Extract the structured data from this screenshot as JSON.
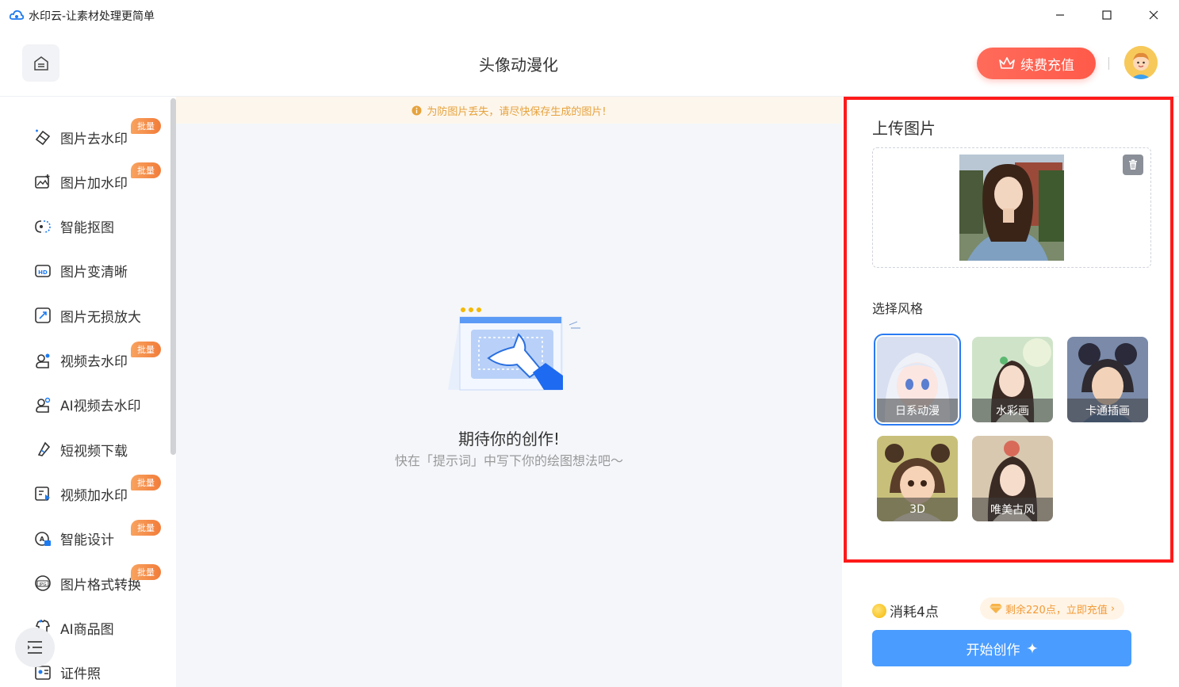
{
  "window": {
    "title": "水印云-让素材处理更简单",
    "minimize_icon": "minimize-icon",
    "maximize_icon": "maximize-icon",
    "close_icon": "close-icon"
  },
  "header": {
    "page_title": "头像动漫化",
    "renew_label": "续费充值",
    "accent": "#ff5a4a"
  },
  "sidebar": {
    "badge_label": "批量",
    "items": [
      {
        "label": "图片去水印",
        "icon": "eraser-icon",
        "badge": true
      },
      {
        "label": "图片加水印",
        "icon": "image-add-icon",
        "badge": true
      },
      {
        "label": "智能抠图",
        "icon": "cutout-icon",
        "badge": false
      },
      {
        "label": "图片变清晰",
        "icon": "hd-icon",
        "badge": false
      },
      {
        "label": "图片无损放大",
        "icon": "enlarge-icon",
        "badge": false
      },
      {
        "label": "视频去水印",
        "icon": "video-eraser-icon",
        "badge": true
      },
      {
        "label": "AI视频去水印",
        "icon": "ai-video-icon",
        "badge": false
      },
      {
        "label": "短视频下载",
        "icon": "download-icon",
        "badge": false
      },
      {
        "label": "视频加水印",
        "icon": "video-add-icon",
        "badge": true
      },
      {
        "label": "智能设计",
        "icon": "design-icon",
        "badge": true
      },
      {
        "label": "图片格式转换",
        "icon": "jpg-icon",
        "badge": true
      },
      {
        "label": "AI商品图",
        "icon": "product-icon",
        "badge": false
      },
      {
        "label": "证件照",
        "icon": "id-photo-icon",
        "badge": false
      }
    ]
  },
  "main": {
    "notice": "为防图片丢失，请尽快保存生成的图片!",
    "empty_title": "期待你的创作!",
    "empty_sub": "快在「提示词」中写下你的绘图想法吧～"
  },
  "panel": {
    "upload_heading": "上传图片",
    "style_heading": "选择风格",
    "styles": [
      {
        "label": "日系动漫",
        "selected": true
      },
      {
        "label": "水彩画",
        "selected": false
      },
      {
        "label": "卡通插画",
        "selected": false
      },
      {
        "label": "3D",
        "selected": false
      },
      {
        "label": "唯美古风",
        "selected": false
      }
    ],
    "highlight_color": "#ff1a1a"
  },
  "footer": {
    "cost": "消耗4点",
    "remain": "剩余220点，立即充值",
    "start_label": "开始创作",
    "button_color": "#4a9cff"
  }
}
